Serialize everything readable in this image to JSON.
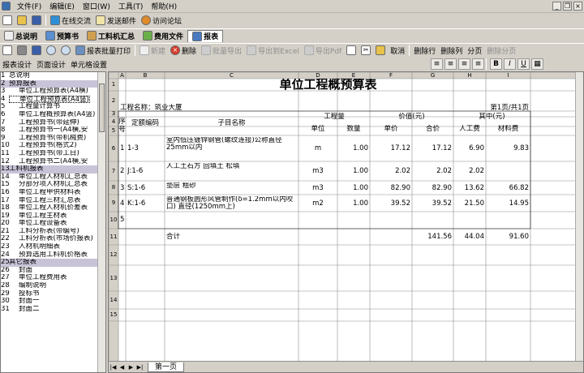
{
  "menu": [
    "文件(F)",
    "编辑(E)",
    "窗口(W)",
    "工具(T)",
    "帮助(H)"
  ],
  "toolbar1": {
    "online": "在线交流",
    "mail": "发送邮件",
    "forum": "访问论坛"
  },
  "tabs": [
    "总说明",
    "预算书",
    "工料机汇总",
    "费用文件",
    "报表"
  ],
  "toolbar3": {
    "print_batch": "报表批量打印",
    "new": "新建",
    "delete": "删除",
    "batch_export": "批量导出",
    "export_excel": "导出到Excel",
    "export_pdf": "导出Pdf",
    "cancel": "取消",
    "del_row": "删除行",
    "del_col": "删除列",
    "split": "分页",
    "del_split": "删除分页"
  },
  "toolbar4": [
    "报表设计",
    "页面设计",
    "单元格设置"
  ],
  "fmt": [
    "B",
    "I",
    "U"
  ],
  "tree": [
    {
      "n": "1",
      "t": "总说明",
      "cat": false,
      "ind": 0
    },
    {
      "n": "2",
      "t": "预算报表",
      "cat": true,
      "ind": 0
    },
    {
      "n": "3",
      "t": "单位工程预算表(A4横)",
      "cat": false,
      "ind": 1
    },
    {
      "n": "4",
      "t": "单位工程预算表(A4竖)",
      "cat": false,
      "ind": 1,
      "sel": true
    },
    {
      "n": "5",
      "t": "工程量计算书",
      "cat": false,
      "ind": 1
    },
    {
      "n": "6",
      "t": "单位工程概预算表(A4竖)",
      "cat": false,
      "ind": 1
    },
    {
      "n": "7",
      "t": "工程预算书(带延伸)",
      "cat": false,
      "ind": 1
    },
    {
      "n": "8",
      "t": "工程预算书一(A4横,安",
      "cat": false,
      "ind": 1
    },
    {
      "n": "9",
      "t": "工程预算书(带机械费)",
      "cat": false,
      "ind": 1
    },
    {
      "n": "10",
      "t": "工程预算书(格式2)",
      "cat": false,
      "ind": 1
    },
    {
      "n": "11",
      "t": "工程预算书(带工日)",
      "cat": false,
      "ind": 1
    },
    {
      "n": "12",
      "t": "工程预算书二(A4横,安",
      "cat": false,
      "ind": 1
    },
    {
      "n": "13",
      "t": "工料机报表",
      "cat": true,
      "ind": 0
    },
    {
      "n": "14",
      "t": "单位工程人材机汇总表",
      "cat": false,
      "ind": 1
    },
    {
      "n": "15",
      "t": "分部分项人材机汇总表",
      "cat": false,
      "ind": 1
    },
    {
      "n": "16",
      "t": "单位工程甲供材料表",
      "cat": false,
      "ind": 1
    },
    {
      "n": "17",
      "t": "单位工程三材汇总表",
      "cat": false,
      "ind": 1
    },
    {
      "n": "18",
      "t": "单位工程人材机价差表",
      "cat": false,
      "ind": 1
    },
    {
      "n": "19",
      "t": "单位工程主材表",
      "cat": false,
      "ind": 1
    },
    {
      "n": "20",
      "t": "单位工程设备表",
      "cat": false,
      "ind": 1
    },
    {
      "n": "21",
      "t": "工料分析表(带编号)",
      "cat": false,
      "ind": 1
    },
    {
      "n": "22",
      "t": "工料分析表(市场价报表)",
      "cat": false,
      "ind": 1
    },
    {
      "n": "23",
      "t": "人材机明细表",
      "cat": false,
      "ind": 1
    },
    {
      "n": "24",
      "t": "预算选用工料机价格表",
      "cat": false,
      "ind": 1
    },
    {
      "n": "25",
      "t": "其它报表",
      "cat": true,
      "ind": 0
    },
    {
      "n": "26",
      "t": "封面",
      "cat": false,
      "ind": 1
    },
    {
      "n": "27",
      "t": "单位工程费用表",
      "cat": false,
      "ind": 1
    },
    {
      "n": "28",
      "t": "编制说明",
      "cat": false,
      "ind": 1
    },
    {
      "n": "29",
      "t": "投标书",
      "cat": false,
      "ind": 1
    },
    {
      "n": "30",
      "t": "封面一",
      "cat": false,
      "ind": 1
    },
    {
      "n": "31",
      "t": "封面二",
      "cat": false,
      "ind": 1
    }
  ],
  "sheet": {
    "cols": [
      "A",
      "B",
      "C",
      "D",
      "E",
      "F",
      "G",
      "H",
      "I"
    ],
    "title": "单位工程概预算表",
    "project": "工程名称：筑业大厦",
    "page": "第1页/共1页",
    "h": {
      "seq": "序号",
      "code": "定额编码",
      "name": "子目名称",
      "qty": "工程量",
      "price": "价值(元)",
      "of": "其中(元)",
      "unit": "单位",
      "amount": "数量",
      "uprice": "单价",
      "total": "合价",
      "labor": "人工费",
      "material": "材料费"
    },
    "rows": [
      {
        "r": "6",
        "seq": "1",
        "code": "1-3",
        "name": "室内低压镀锌钢管(螺纹连接)公称直径25mm以内",
        "unit": "m",
        "qty": "1.00",
        "price": "17.12",
        "total": "17.12",
        "labor": "6.90",
        "mat": "9.83"
      },
      {
        "r": "7",
        "seq": "2",
        "code": "J:1-6",
        "name": "人工土石方 回填土 松填",
        "unit": "m3",
        "qty": "1.00",
        "price": "2.02",
        "total": "2.02",
        "labor": "2.02",
        "mat": ""
      },
      {
        "r": "8",
        "seq": "3",
        "code": "S:1-6",
        "name": "垫层 粗砂",
        "unit": "m3",
        "qty": "1.00",
        "price": "82.90",
        "total": "82.90",
        "labor": "13.62",
        "mat": "66.82"
      },
      {
        "r": "9",
        "seq": "4",
        "code": "K:1-6",
        "name": "普通钢板圆形风管制作(δ=1.2mm以内咬口) 直径(1250mm上)",
        "unit": "m2",
        "qty": "1.00",
        "price": "39.52",
        "total": "39.52",
        "labor": "21.50",
        "mat": "14.95"
      }
    ],
    "r10": "5",
    "sum": {
      "label": "合计",
      "total": "141.56",
      "labor": "44.04",
      "mat": "91.60"
    },
    "tabname": "第一页",
    "rownums": [
      "1",
      "2",
      "3",
      "4",
      "5",
      "6",
      "7",
      "8",
      "9",
      "10",
      "11",
      "12",
      "13",
      "14",
      "15"
    ]
  },
  "colors": {
    "cat": "#c9c3d8",
    "chrome": "#d4d0c8"
  }
}
